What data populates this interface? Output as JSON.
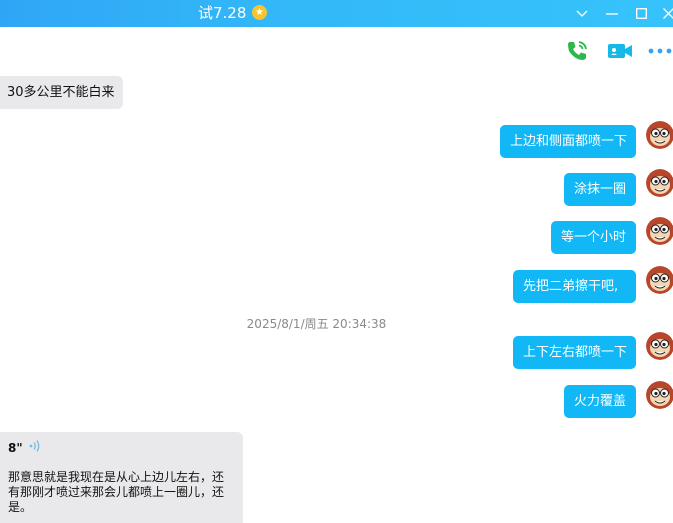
{
  "window": {
    "title": "试7.28",
    "star_glyph": "★"
  },
  "toolbar": {
    "phone_icon": "phone-icon",
    "video_icon": "video-icon",
    "more_icon": "more-icon"
  },
  "messages": {
    "in_1": "30多公里不能白来",
    "out_1": "上边和侧面都喷一下",
    "out_2": "涂抹一圈",
    "out_3": "等一个小时",
    "out_4": "先把二弟擦干吧,",
    "timestamp": "2025/8/1/周五 20:34:38",
    "out_5": "上下左右都喷一下",
    "out_6": "火力覆盖"
  },
  "voice": {
    "duration": "8\"",
    "transcript": "那意思就是我现在是从心上边儿左右，还有那刚才喷过来那会儿都喷上一圈儿，还是。"
  },
  "colors": {
    "titlebar": "#33b7f8",
    "bubble_out": "#12b7f5",
    "bubble_in": "#e9e9eb",
    "phone_green": "#2db84d",
    "video_teal": "#15b9e8",
    "more_blue": "#3aa0f0"
  }
}
